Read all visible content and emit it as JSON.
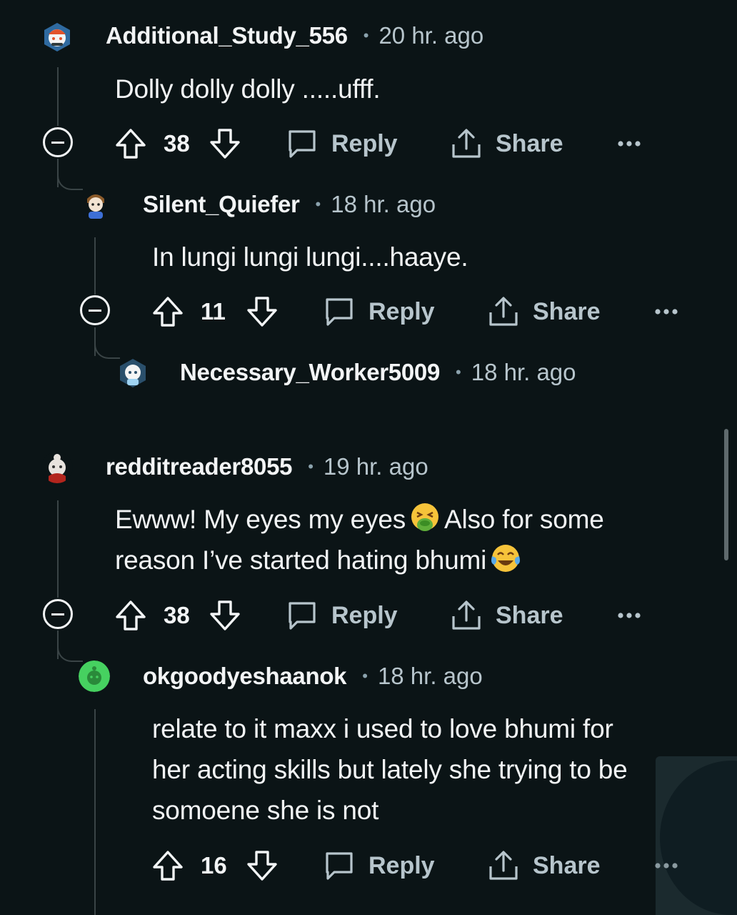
{
  "comments": [
    {
      "username": "Additional_Study_556",
      "time": "20 hr. ago",
      "body": "Dolly dolly dolly .....ufff.",
      "score": "38",
      "reply_label": "Reply",
      "share_label": "Share",
      "avatar_colors": {
        "bg": "#2f3a3c",
        "accent": "#e2532b"
      }
    },
    {
      "username": "Silent_Quiefer",
      "time": "18 hr. ago",
      "body": "In lungi lungi lungi....haaye.",
      "score": "11",
      "reply_label": "Reply",
      "share_label": "Share",
      "avatar_colors": {
        "bg": "#e9e4dc",
        "accent": "#3d6fd6"
      }
    },
    {
      "username": "Necessary_Worker5009",
      "time": "18 hr. ago",
      "avatar_colors": {
        "bg": "#2a4f6b",
        "accent": "#9fd3f2"
      }
    },
    {
      "username": "redditreader8055",
      "time": "19 hr. ago",
      "body_line1": "Ewww! My eyes my eyes",
      "body_line1_end": "Also for some",
      "body_line2": "reason I’ve started hating bhumi",
      "score": "38",
      "reply_label": "Reply",
      "share_label": "Share",
      "avatar_colors": {
        "bg": "#d9d4cf",
        "accent": "#b3251d"
      }
    },
    {
      "username": "okgoodyeshaanok",
      "time": "18 hr. ago",
      "body_lines": [
        "relate to it maxx i used to love bhumi for",
        "her acting skills but lately she trying to be",
        "somoene she is not"
      ],
      "score": "16",
      "reply_label": "Reply",
      "share_label": "Share",
      "avatar_colors": {
        "bg": "#46d160",
        "accent": "#2a8a3a"
      }
    }
  ],
  "icons": {
    "upvote": "arrow-up-outline-icon",
    "downvote": "arrow-down-outline-icon",
    "reply": "speech-bubble-icon",
    "share": "share-upload-icon",
    "more": "ellipsis-icon",
    "collapse": "collapse-minus-icon",
    "emoji_1": "face-vomiting-emoji",
    "emoji_2": "face-tears-of-joy-emoji"
  },
  "colors": {
    "background": "#0b1416",
    "text": "#f2f4f5",
    "secondary_text": "#b7c5cc",
    "thread_line": "#3a4446"
  }
}
